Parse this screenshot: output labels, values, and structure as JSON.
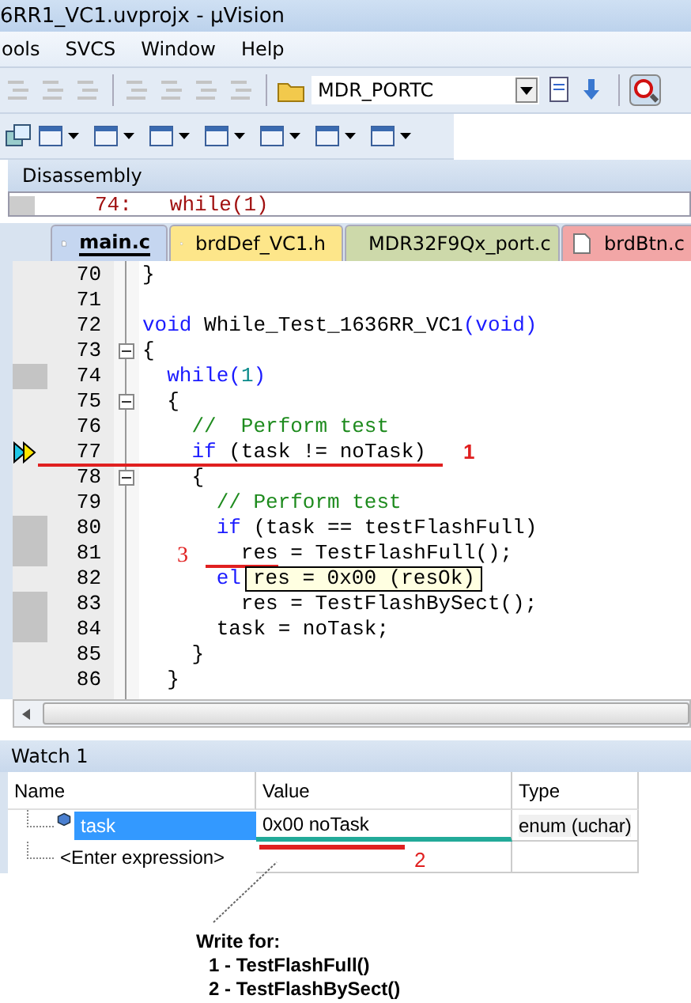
{
  "window": {
    "title": "6RR1_VC1.uvprojx - µVision"
  },
  "menu": [
    "ools",
    "SVCS",
    "Window",
    "Help"
  ],
  "toolbar1": [
    {
      "disabled": true
    },
    {
      "disabled": true
    },
    {
      "disabled": true
    },
    {
      "disabled": true
    },
    {
      "disabled": true
    },
    {
      "disabled": true
    },
    {
      "disabled": true
    }
  ],
  "target_combo": {
    "value": "MDR_PORTC"
  },
  "disassembly": {
    "title": "Disassembly",
    "line_number": "74:",
    "code": "while(1)"
  },
  "tabs": [
    {
      "label": "main.c",
      "selected": true,
      "color": "#c5d6f0"
    },
    {
      "label": "brdDef_VC1.h",
      "selected": false,
      "color": "#fde68a"
    },
    {
      "label": "MDR32F9Qx_port.c",
      "selected": false,
      "color": "#cdd9aa"
    },
    {
      "label": "brdBtn.c",
      "selected": false,
      "color": "#f2a6a6"
    }
  ],
  "lines": [
    {
      "num": "70",
      "collapsible": false,
      "marked": false,
      "current": false,
      "tokens": [
        {
          "kind": "text",
          "text": "}"
        }
      ]
    },
    {
      "num": "71",
      "collapsible": false,
      "marked": false,
      "current": false
    },
    {
      "num": "72",
      "collapsible": false,
      "marked": false,
      "current": false,
      "tokens": [
        {
          "kind": "kw",
          "text": "void"
        },
        {
          "kind": "text",
          "text": " While_Test_1636RR_VC1"
        },
        {
          "kind": "kw",
          "text": "(void)"
        }
      ]
    },
    {
      "num": "73",
      "collapsible": true,
      "marked": false,
      "current": false,
      "tokens": [
        {
          "kind": "text",
          "text": "{"
        }
      ]
    },
    {
      "num": "74",
      "collapsible": false,
      "marked": true,
      "current": false,
      "tokens": [
        {
          "kind": "kw",
          "text": "  while"
        },
        {
          "kind": "kw",
          "text": "("
        },
        {
          "kind": "num",
          "text": "1"
        },
        {
          "kind": "kw",
          "text": ")"
        }
      ]
    },
    {
      "num": "75",
      "collapsible": true,
      "marked": false,
      "current": false,
      "tokens": [
        {
          "kind": "text",
          "text": "  {"
        }
      ]
    },
    {
      "num": "76",
      "collapsible": false,
      "marked": false,
      "current": false,
      "tokens": [
        {
          "kind": "comment",
          "text": "    //  Perform test"
        }
      ]
    },
    {
      "num": "77",
      "collapsible": false,
      "marked": false,
      "current": true,
      "mark": {
        "label": "1",
        "kind": "line"
      },
      "tokens": [
        {
          "kind": "kw",
          "text": "    if"
        },
        {
          "kind": "text",
          "text": " (task != noTask)"
        }
      ]
    },
    {
      "num": "78",
      "collapsible": true,
      "marked": false,
      "current": false,
      "tokens": [
        {
          "kind": "text",
          "text": "    {"
        }
      ]
    },
    {
      "num": "79",
      "collapsible": false,
      "marked": false,
      "current": false,
      "tokens": [
        {
          "kind": "comment",
          "text": "      // Perform test"
        }
      ]
    },
    {
      "num": "80",
      "collapsible": false,
      "marked": true,
      "current": false,
      "tokens": [
        {
          "kind": "kw",
          "text": "      if"
        },
        {
          "kind": "text",
          "text": " (task == testFlashFull)"
        }
      ]
    },
    {
      "num": "81",
      "collapsible": false,
      "marked": true,
      "current": false,
      "mark": {
        "label": "3",
        "kind": "word"
      },
      "tokens": [
        {
          "kind": "text",
          "text": "        res = TestFlashFull();"
        }
      ]
    },
    {
      "num": "82",
      "collapsible": false,
      "marked": false,
      "current": false,
      "tooltip": "res = 0x00 (resOk)",
      "tokens": [
        {
          "kind": "kw",
          "text": "      el"
        }
      ]
    },
    {
      "num": "83",
      "collapsible": false,
      "marked": true,
      "current": false,
      "tokens": [
        {
          "kind": "text",
          "text": "        res = TestFlashBySect();"
        }
      ]
    },
    {
      "num": "84",
      "collapsible": false,
      "marked": true,
      "current": false,
      "tokens": [
        {
          "kind": "text",
          "text": "      task = noTask;"
        }
      ]
    },
    {
      "num": "85",
      "collapsible": false,
      "marked": false,
      "current": false,
      "tokens": [
        {
          "kind": "text",
          "text": "    }"
        }
      ]
    },
    {
      "num": "86",
      "collapsible": false,
      "marked": false,
      "current": false,
      "tokens": [
        {
          "kind": "text",
          "text": "  }"
        }
      ]
    }
  ],
  "watch": {
    "title": "Watch 1",
    "columns": [
      "Name",
      "Value",
      "Type"
    ],
    "rows": [
      {
        "name": "task",
        "value": "0x00 noTask",
        "type": "enum (uchar)",
        "selected": true,
        "mark": "2"
      },
      {
        "name": "<Enter expression>",
        "selected": false
      }
    ]
  },
  "note": {
    "title": "Write for:",
    "items": [
      "1 - TestFlashFull()",
      "2 - TestFlashBySect()"
    ]
  }
}
